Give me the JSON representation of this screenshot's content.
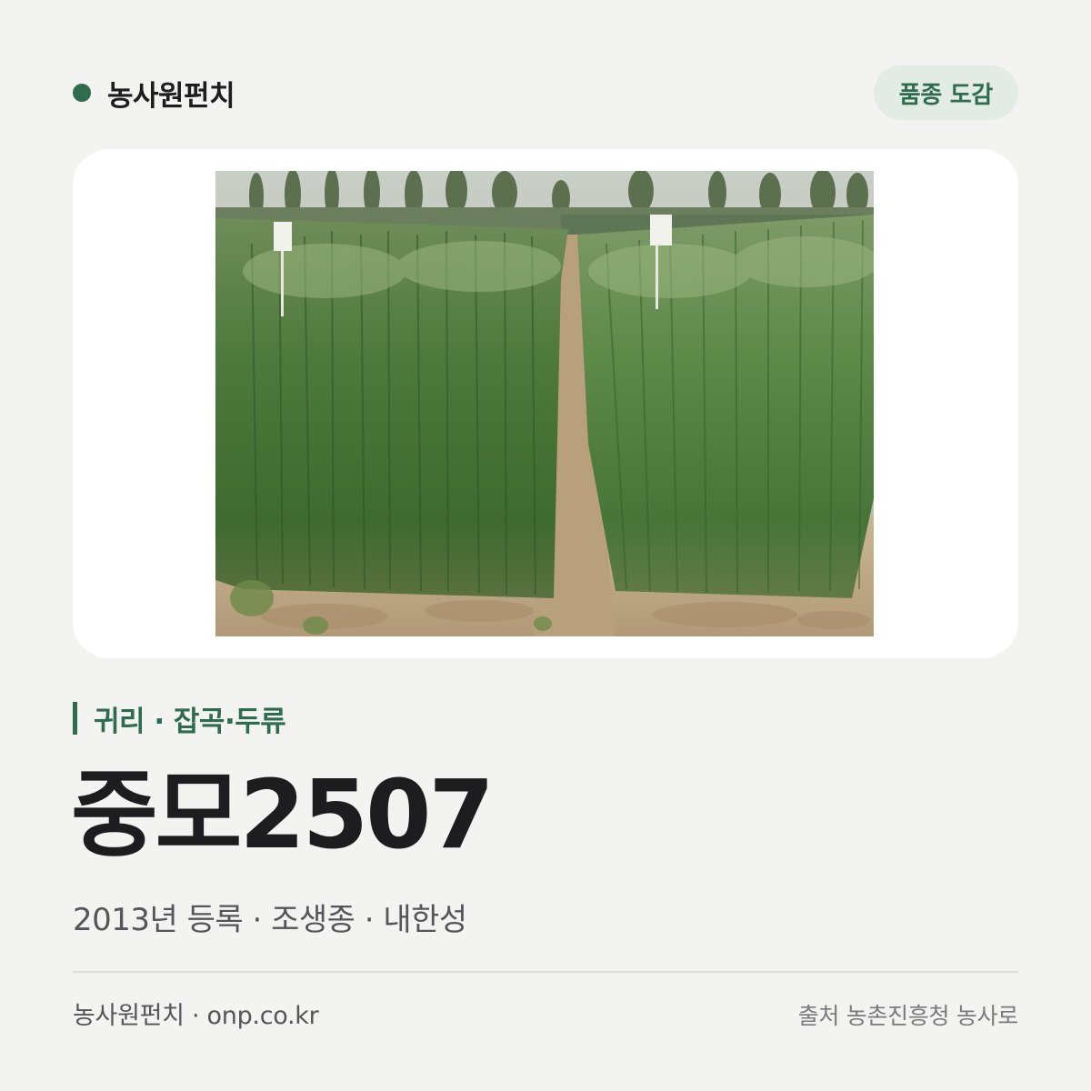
{
  "header": {
    "brand_name": "농사원펀치",
    "badge_label": "품종 도감"
  },
  "card": {
    "photo_icon": "oat-field-photo"
  },
  "variety": {
    "category": "귀리 · 잡곡·두류",
    "name": "중모2507",
    "meta": "2013년 등록 · 조생종 · 내한성"
  },
  "footer": {
    "site": "농사원펀치 · onp.co.kr",
    "source": "출처 농촌진흥청 농사로"
  },
  "colors": {
    "background": "#f3f3f1",
    "accent": "#2e6b4f",
    "badge_bg": "#e3ebe5",
    "title": "#1d1d1f"
  }
}
